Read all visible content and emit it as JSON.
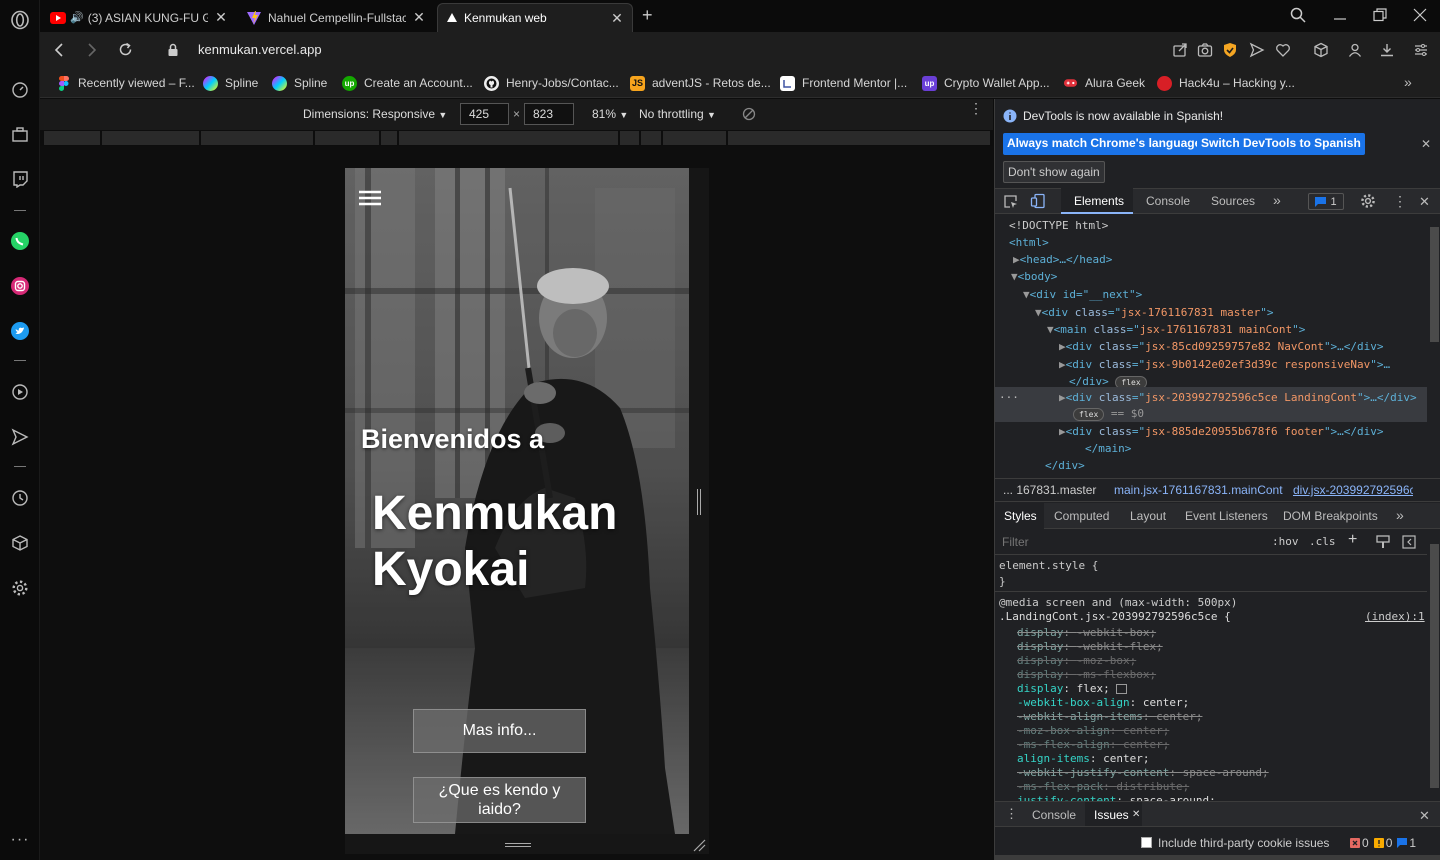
{
  "browser": {
    "tabs": [
      {
        "title": "(3) ASIAN KUNG-FU GE",
        "favicon": "youtube-icon",
        "audio": true
      },
      {
        "title": "Nahuel Cempellin-Fullstack",
        "favicon": "vite-icon"
      },
      {
        "title": "Kenmukan web",
        "favicon": "vercel-icon",
        "active": true
      }
    ],
    "new_tab": "+",
    "url": "kenmukan.vercel.app",
    "bookmarks": [
      {
        "label": "Recently viewed – F...",
        "icon": "figma-icon"
      },
      {
        "label": "Spline",
        "icon": "spline-icon"
      },
      {
        "label": "Spline",
        "icon": "spline-icon"
      },
      {
        "label": "Create an Account...",
        "icon": "upwork-icon"
      },
      {
        "label": "Henry-Jobs/Contac...",
        "icon": "github-icon"
      },
      {
        "label": "adventJS - Retos de...",
        "icon": "js-icon"
      },
      {
        "label": "Frontend Mentor |...",
        "icon": "frontend-mentor-icon"
      },
      {
        "label": "Crypto Wallet App...",
        "icon": "upwork-icon"
      },
      {
        "label": "Alura Geek",
        "icon": "game-icon"
      },
      {
        "label": "Hack4u – Hacking y...",
        "icon": "hack4u-icon"
      }
    ]
  },
  "device_toolbar": {
    "dimensions_label": "Dimensions: Responsive",
    "width": "425",
    "height": "823",
    "times": "×",
    "zoom": "81%",
    "throttling": "No throttling"
  },
  "site": {
    "welcome": "Bienvenidos a",
    "title_line1": "Kenmukan",
    "title_line2": "Kyokai",
    "btn_more": "Mas info...",
    "btn_kendo": "¿Que es kendo y iaido?"
  },
  "devtools": {
    "banner_text": "DevTools is now available in Spanish!",
    "btn_match": "Always match Chrome's language",
    "btn_switch": "Switch DevTools to Spanish",
    "btn_dont_show": "Don't show again",
    "tabs": [
      "Elements",
      "Console",
      "Sources"
    ],
    "issues_count": "1",
    "dom": {
      "doctype": "<!DOCTYPE html>",
      "html": "<html>",
      "head": "<head>…</head>",
      "body": "<body>",
      "next_div": "<div id=\"__next\">",
      "master_div_class": "jsx-1761167831 master",
      "main_class": "jsx-1761167831 mainCont",
      "navcont_class": "jsx-85cd09259757e82 NavCont",
      "responsive_class": "jsx-9b0142e02ef3d39c responsiveNav",
      "landing_class": "jsx-203992792596c5ce LandingCont",
      "footer_class": "jsx-885de20955b678f6 footer",
      "badge": "flex",
      "selected_marker": "== $0"
    },
    "breadcrumbs": [
      "... 167831.master",
      "main.jsx-1761167831.mainCont",
      "div.jsx-203992792596c"
    ],
    "styles_tabs": [
      "Styles",
      "Computed",
      "Layout",
      "Event Listeners",
      "DOM Breakpoints"
    ],
    "filter_placeholder": "Filter",
    "hov": ":hov",
    "cls": ".cls",
    "element_style": "element.style {",
    "close_brace": "}",
    "media_query": "@media screen and (max-width: 500px)",
    "rule_selector": ".LandingCont.jsx-203992792596c5ce {",
    "rule_source": "(index):1",
    "css_lines": [
      {
        "prop": "display",
        "value": "-webkit-box;",
        "strike": true
      },
      {
        "prop": "display",
        "value": "-webkit-flex;",
        "strike": true
      },
      {
        "prop": "display",
        "value": "-moz-box;",
        "strike": true,
        "dim": true
      },
      {
        "prop": "display",
        "value": "-ms-flexbox;",
        "strike": true,
        "dim": true
      },
      {
        "prop": "display",
        "value": "flex;",
        "strike": false
      },
      {
        "prop": "-webkit-box-align",
        "value": "center;",
        "strike": false
      },
      {
        "prop": "-webkit-align-items",
        "value": "center;",
        "strike": true
      },
      {
        "prop": "-moz-box-align",
        "value": "center;",
        "strike": true,
        "dim": true
      },
      {
        "prop": "-ms-flex-align",
        "value": "center;",
        "strike": true,
        "dim": true
      },
      {
        "prop": "align-items",
        "value": "center;",
        "strike": false
      },
      {
        "prop": "-webkit-justify-content",
        "value": "space-around;",
        "strike": true
      },
      {
        "prop": "-ms-flex-pack",
        "value": "distribute;",
        "strike": true,
        "dim": true
      },
      {
        "prop": "justify-content",
        "value": "space-around;",
        "strike": false
      }
    ],
    "drawer_tabs": [
      "Console",
      "Issues"
    ],
    "third_party": "Include third-party cookie issues",
    "counts": {
      "errors": "0",
      "warnings": "0",
      "info": "1"
    }
  },
  "colors": {
    "accent_blue": "#1a73e8",
    "tag_blue": "#5db0d7",
    "attr_value_orange": "#f29766",
    "css_prop_teal": "#35d4c7"
  }
}
